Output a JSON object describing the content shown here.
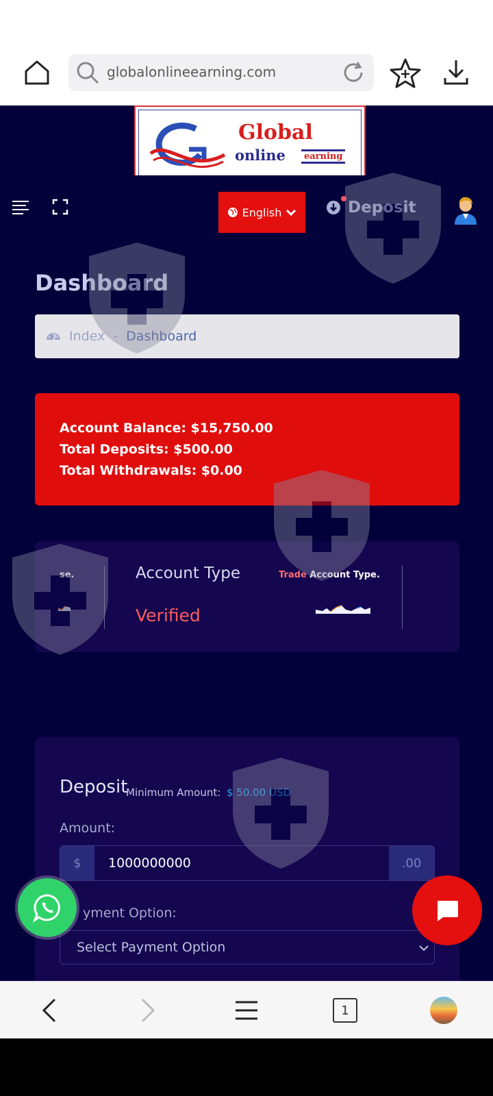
{
  "browser": {
    "url": "globalonlineearning.com",
    "tab_count": "1"
  },
  "logo": {
    "word1": "Global",
    "word2": "online",
    "word3": "earning"
  },
  "header": {
    "language": "English",
    "deposit_link": "Deposit"
  },
  "page": {
    "title": "Dashboard",
    "breadcrumb": {
      "index": "Index",
      "separator": "-",
      "current": "Dashboard"
    }
  },
  "balance": {
    "account_balance": "Account Balance: $15,750.00",
    "total_deposits": "Total Deposits: $500.00",
    "total_withdrawals": "Total Withdrawals: $0.00"
  },
  "account": {
    "left_fragment": "se.",
    "type_label": "Account Type",
    "type_value": "Verified",
    "trade_word": "Trade",
    "trade_rest": "Account Type."
  },
  "deposit": {
    "title": "Deposit",
    "min_label": "Minimum Amount:",
    "min_value": "$ 50.00 USD",
    "amount_label": "Amount:",
    "currency_prefix": "$",
    "amount_value": "1000000000",
    "cents_suffix": ".00",
    "payment_label": "yment Option:",
    "payment_placeholder": "Select Payment Option"
  },
  "colors": {
    "site_bg": "#02013a",
    "card_bg": "#14064f",
    "accent_red": "#e00d0d",
    "whatsapp_green": "#2fd36a",
    "link_blue": "#1fa0f0"
  }
}
